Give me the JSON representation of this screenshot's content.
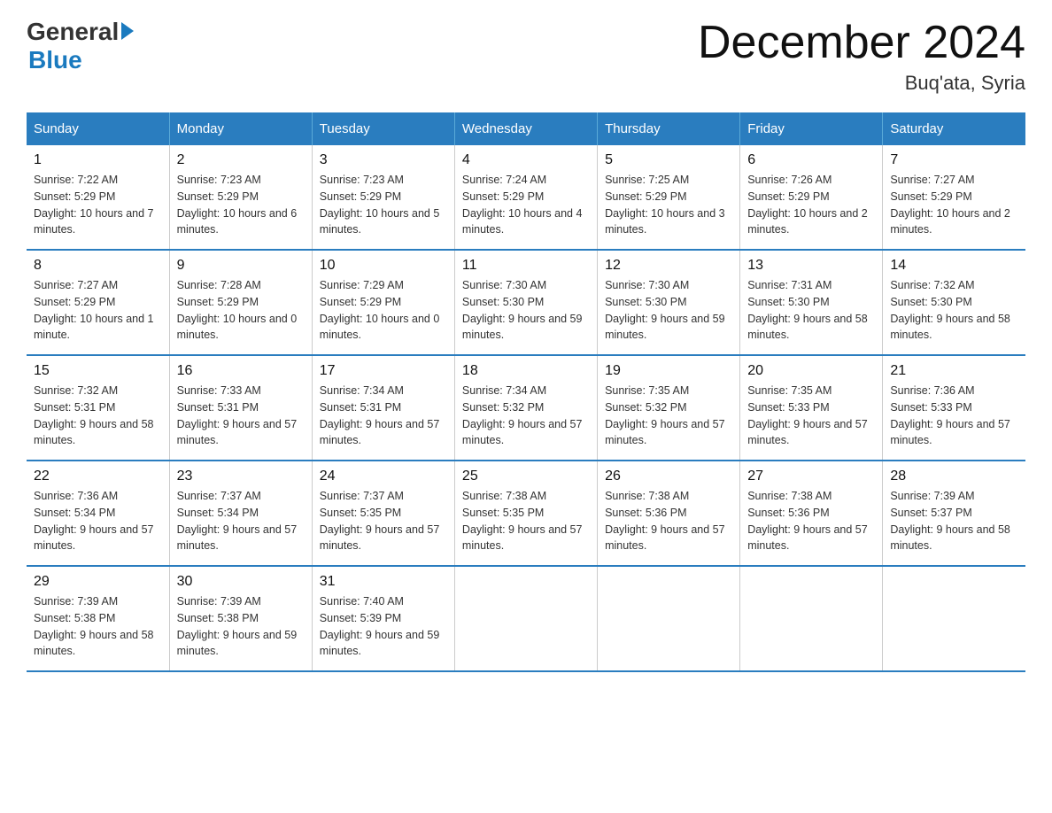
{
  "logo": {
    "general": "General",
    "blue": "Blue"
  },
  "header": {
    "month_year": "December 2024",
    "location": "Buq'ata, Syria"
  },
  "days_of_week": [
    "Sunday",
    "Monday",
    "Tuesday",
    "Wednesday",
    "Thursday",
    "Friday",
    "Saturday"
  ],
  "weeks": [
    [
      {
        "day": "1",
        "sunrise": "7:22 AM",
        "sunset": "5:29 PM",
        "daylight": "10 hours and 7 minutes."
      },
      {
        "day": "2",
        "sunrise": "7:23 AM",
        "sunset": "5:29 PM",
        "daylight": "10 hours and 6 minutes."
      },
      {
        "day": "3",
        "sunrise": "7:23 AM",
        "sunset": "5:29 PM",
        "daylight": "10 hours and 5 minutes."
      },
      {
        "day": "4",
        "sunrise": "7:24 AM",
        "sunset": "5:29 PM",
        "daylight": "10 hours and 4 minutes."
      },
      {
        "day": "5",
        "sunrise": "7:25 AM",
        "sunset": "5:29 PM",
        "daylight": "10 hours and 3 minutes."
      },
      {
        "day": "6",
        "sunrise": "7:26 AM",
        "sunset": "5:29 PM",
        "daylight": "10 hours and 2 minutes."
      },
      {
        "day": "7",
        "sunrise": "7:27 AM",
        "sunset": "5:29 PM",
        "daylight": "10 hours and 2 minutes."
      }
    ],
    [
      {
        "day": "8",
        "sunrise": "7:27 AM",
        "sunset": "5:29 PM",
        "daylight": "10 hours and 1 minute."
      },
      {
        "day": "9",
        "sunrise": "7:28 AM",
        "sunset": "5:29 PM",
        "daylight": "10 hours and 0 minutes."
      },
      {
        "day": "10",
        "sunrise": "7:29 AM",
        "sunset": "5:29 PM",
        "daylight": "10 hours and 0 minutes."
      },
      {
        "day": "11",
        "sunrise": "7:30 AM",
        "sunset": "5:30 PM",
        "daylight": "9 hours and 59 minutes."
      },
      {
        "day": "12",
        "sunrise": "7:30 AM",
        "sunset": "5:30 PM",
        "daylight": "9 hours and 59 minutes."
      },
      {
        "day": "13",
        "sunrise": "7:31 AM",
        "sunset": "5:30 PM",
        "daylight": "9 hours and 58 minutes."
      },
      {
        "day": "14",
        "sunrise": "7:32 AM",
        "sunset": "5:30 PM",
        "daylight": "9 hours and 58 minutes."
      }
    ],
    [
      {
        "day": "15",
        "sunrise": "7:32 AM",
        "sunset": "5:31 PM",
        "daylight": "9 hours and 58 minutes."
      },
      {
        "day": "16",
        "sunrise": "7:33 AM",
        "sunset": "5:31 PM",
        "daylight": "9 hours and 57 minutes."
      },
      {
        "day": "17",
        "sunrise": "7:34 AM",
        "sunset": "5:31 PM",
        "daylight": "9 hours and 57 minutes."
      },
      {
        "day": "18",
        "sunrise": "7:34 AM",
        "sunset": "5:32 PM",
        "daylight": "9 hours and 57 minutes."
      },
      {
        "day": "19",
        "sunrise": "7:35 AM",
        "sunset": "5:32 PM",
        "daylight": "9 hours and 57 minutes."
      },
      {
        "day": "20",
        "sunrise": "7:35 AM",
        "sunset": "5:33 PM",
        "daylight": "9 hours and 57 minutes."
      },
      {
        "day": "21",
        "sunrise": "7:36 AM",
        "sunset": "5:33 PM",
        "daylight": "9 hours and 57 minutes."
      }
    ],
    [
      {
        "day": "22",
        "sunrise": "7:36 AM",
        "sunset": "5:34 PM",
        "daylight": "9 hours and 57 minutes."
      },
      {
        "day": "23",
        "sunrise": "7:37 AM",
        "sunset": "5:34 PM",
        "daylight": "9 hours and 57 minutes."
      },
      {
        "day": "24",
        "sunrise": "7:37 AM",
        "sunset": "5:35 PM",
        "daylight": "9 hours and 57 minutes."
      },
      {
        "day": "25",
        "sunrise": "7:38 AM",
        "sunset": "5:35 PM",
        "daylight": "9 hours and 57 minutes."
      },
      {
        "day": "26",
        "sunrise": "7:38 AM",
        "sunset": "5:36 PM",
        "daylight": "9 hours and 57 minutes."
      },
      {
        "day": "27",
        "sunrise": "7:38 AM",
        "sunset": "5:36 PM",
        "daylight": "9 hours and 57 minutes."
      },
      {
        "day": "28",
        "sunrise": "7:39 AM",
        "sunset": "5:37 PM",
        "daylight": "9 hours and 58 minutes."
      }
    ],
    [
      {
        "day": "29",
        "sunrise": "7:39 AM",
        "sunset": "5:38 PM",
        "daylight": "9 hours and 58 minutes."
      },
      {
        "day": "30",
        "sunrise": "7:39 AM",
        "sunset": "5:38 PM",
        "daylight": "9 hours and 59 minutes."
      },
      {
        "day": "31",
        "sunrise": "7:40 AM",
        "sunset": "5:39 PM",
        "daylight": "9 hours and 59 minutes."
      },
      null,
      null,
      null,
      null
    ]
  ],
  "cell_labels": {
    "sunrise": "Sunrise: ",
    "sunset": "Sunset: ",
    "daylight": "Daylight: "
  }
}
